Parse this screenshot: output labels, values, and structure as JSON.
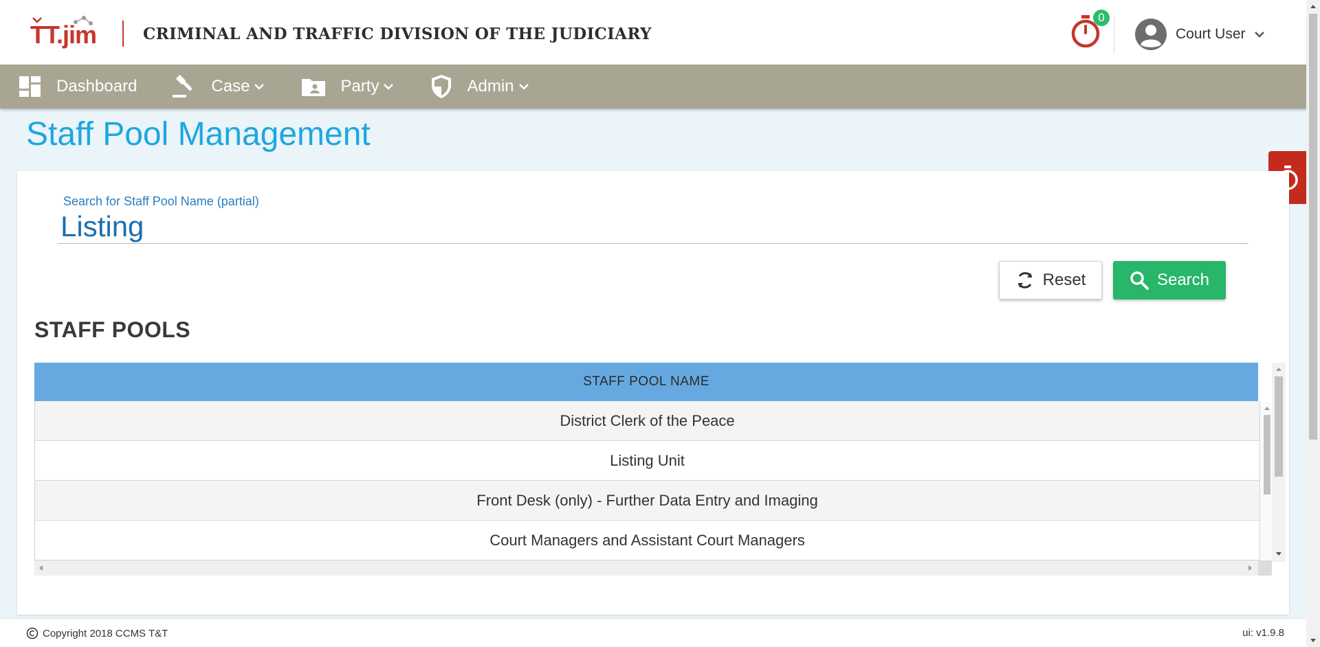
{
  "header": {
    "logo_text": "TT.jim",
    "title": "CRIMINAL AND TRAFFIC DIVISION OF THE JUDICIARY",
    "timer_count": "0",
    "user_name": "Court User"
  },
  "nav": {
    "items": [
      {
        "label": "Dashboard",
        "icon": "dashboard-icon"
      },
      {
        "label": "Case",
        "icon": "gavel-icon"
      },
      {
        "label": "Party",
        "icon": "folder-person-icon"
      },
      {
        "label": "Admin",
        "icon": "shield-icon"
      }
    ]
  },
  "page": {
    "title": "Staff Pool Management"
  },
  "search": {
    "label": "Search for Staff Pool Name (partial)",
    "value": "Listing",
    "reset_label": "Reset",
    "search_label": "Search"
  },
  "table": {
    "section_title": "STAFF POOLS",
    "column": "STAFF POOL NAME",
    "rows": [
      "District Clerk of the Peace",
      "Listing Unit",
      "Front Desk (only) - Further Data Entry and Imaging",
      "Court Managers and Assistant Court Managers"
    ]
  },
  "footer": {
    "copyright": "Copyright 2018  CCMS T&T",
    "version": "ui: v1.9.8"
  },
  "colors": {
    "brand_red": "#c8352a",
    "nav_bg": "#a8a593",
    "title_blue": "#1ea7e0",
    "table_head": "#66a9e0",
    "search_green": "#27b66a"
  }
}
